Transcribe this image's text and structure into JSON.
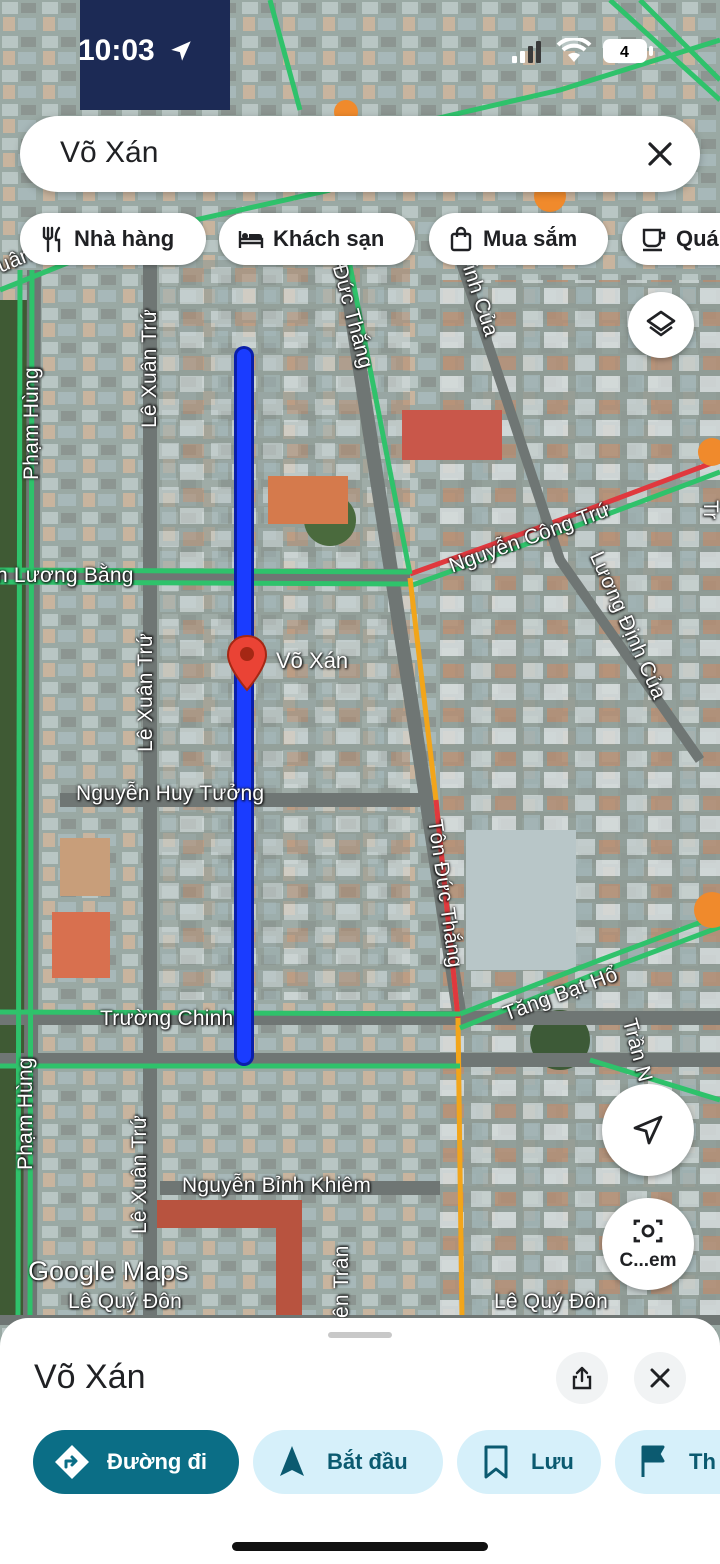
{
  "status_bar": {
    "time": "10:03",
    "battery": "4"
  },
  "search": {
    "query": "Võ Xán"
  },
  "chips": [
    {
      "label": "Nhà hàng",
      "icon": "restaurant-icon"
    },
    {
      "label": "Khách sạn",
      "icon": "hotel-icon"
    },
    {
      "label": "Mua sắm",
      "icon": "shopping-bag-icon"
    },
    {
      "label": "Quá",
      "icon": "coffee-icon"
    }
  ],
  "map": {
    "pin_label": "Võ Xán",
    "attribution": "Google Maps",
    "camera_label": "C...em",
    "streets": [
      "uân Thường",
      "Phạm Hùng",
      "Lê Xuân Trứ",
      "Đức Thắng",
      "inh Của",
      "n Lương Bằng",
      "Nguyễn Công Trứ",
      "Lương Định Của",
      "Lê Xuân Trứ",
      "Nguyễn Huy Tưởng",
      "Tôn Đức Thắng",
      "Tăng Bạt Hổ",
      "Trường Chinh",
      "Trần N",
      "Phạm Hùng",
      "Lê Xuân Trứ",
      "Nguyễn Bỉnh Khiêm",
      "ên Trân",
      "Lê Quý Đôn",
      "Lê Quý Đôn",
      "Tr"
    ]
  },
  "place": {
    "title": "Võ Xán",
    "actions": [
      {
        "label": "Đường đi",
        "icon": "directions-icon"
      },
      {
        "label": "Bắt đầu",
        "icon": "navigation-arrow-icon"
      },
      {
        "label": "Lưu",
        "icon": "bookmark-icon"
      },
      {
        "label": "Th",
        "icon": "flag-icon"
      }
    ]
  },
  "colors": {
    "route": "#1a3cff",
    "pin": "#ea4335",
    "primary_action": "#0b6e86",
    "secondary_action": "#d6f0fa",
    "traffic_green": "#2fc26b",
    "traffic_orange": "#f2a51a",
    "traffic_red": "#e0383e"
  }
}
